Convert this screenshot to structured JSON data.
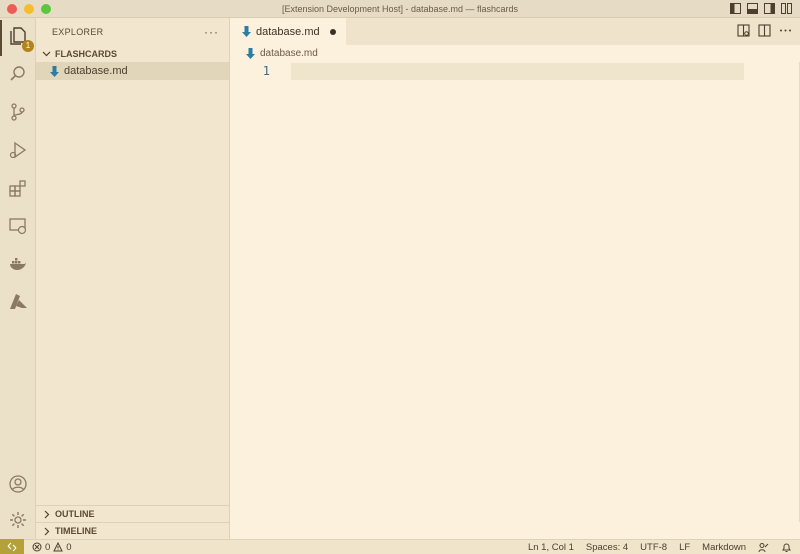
{
  "window": {
    "title": "[Extension Development Host] - database.md — flashcards"
  },
  "activity": {
    "explorer_badge": "1"
  },
  "sidebar": {
    "title": "EXPLORER",
    "more": "···",
    "folder": "FLASHCARDS",
    "files": [
      {
        "name": "database.md"
      }
    ],
    "bottom_sections": [
      {
        "label": "OUTLINE"
      },
      {
        "label": "TIMELINE"
      }
    ]
  },
  "editor": {
    "tab": {
      "label": "database.md"
    },
    "breadcrumb": "database.md",
    "line_numbers": [
      "1"
    ]
  },
  "status": {
    "errors": "0",
    "warnings": "0",
    "position": "Ln 1, Col 1",
    "spaces": "Spaces: 4",
    "encoding": "UTF-8",
    "eol": "LF",
    "language": "Markdown"
  },
  "colors": {
    "accent": "#b5821b",
    "md_icon": "#2b7da6",
    "remote": "#b5a13a"
  }
}
